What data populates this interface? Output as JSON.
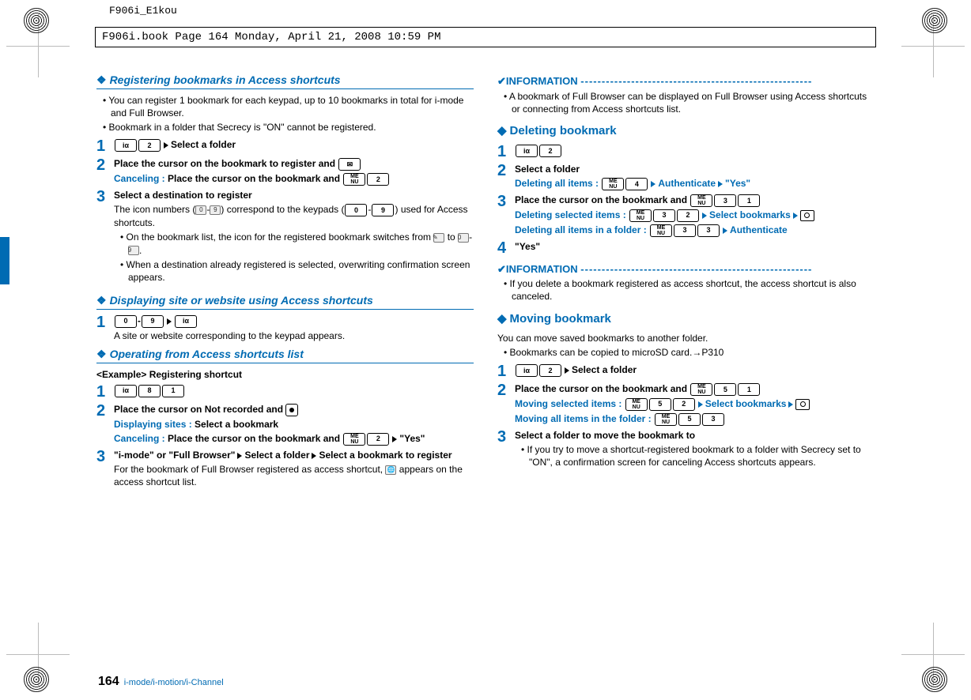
{
  "doc": {
    "id": "F906i_E1kou",
    "book_info": "F906i.book  Page 164  Monday, April 21, 2008  10:59 PM",
    "page_number": "164",
    "footer": "i-mode/i-motion/i-Channel"
  },
  "keys": {
    "i": "iα",
    "menu": "ME\nNU",
    "n0": "0",
    "n1": "1",
    "n2": "2",
    "n3": "3",
    "n4": "4",
    "n5": "5",
    "n8": "8",
    "n9": "9",
    "mail": "✉"
  },
  "left": {
    "s1": {
      "title": "Registering bookmarks in Access shortcuts",
      "b1": "You can register 1 bookmark for each keypad, up to 10 bookmarks in total for i-mode and Full Browser.",
      "b2": "Bookmark in a folder that Secrecy is \"ON\" cannot be registered.",
      "step1_tail": "Select a folder",
      "step2_title": "Place the cursor on the bookmark to register and ",
      "step2_cancel_label": "Canceling : ",
      "step2_cancel_text": "Place the cursor on the bookmark and ",
      "step3_title": "Select a destination to register",
      "step3_text": "The icon numbers ( - ) correspond to the keypads ( - ) used for Access shortcuts.",
      "step3_prefix": "The icon numbers (",
      "step3_mid": ") correspond to the keypads (",
      "step3_suffix": ") used for Access shortcuts.",
      "step3_b1a": "On the bookmark list, the icon for the registered bookmark switches from ",
      "step3_b1b": " to ",
      "step3_b1c": ".",
      "step3_b2": "When a destination already registered is selected, overwriting confirmation screen appears."
    },
    "s2": {
      "title": "Displaying site or website using Access shortcuts",
      "step1_text": "A site or website corresponding to the keypad appears."
    },
    "s3": {
      "title": "Operating from Access shortcuts list",
      "example": "<Example> Registering shortcut",
      "step2_title": "Place the cursor on Not recorded and ",
      "step2_disp_label": "Displaying sites : ",
      "step2_disp_text": "Select a bookmark",
      "step2_cancel_label": "Canceling : ",
      "step2_cancel_text": "Place the cursor on the bookmark and ",
      "step2_cancel_tail": "\"Yes\"",
      "step3_a": "\"i-mode\" or \"Full Browser\"",
      "step3_b": "Select a folder",
      "step3_c": "Select a bookmark to register",
      "step3_text_a": "For the bookmark of Full Browser registered as access shortcut, ",
      "step3_text_b": " appears on the access shortcut list."
    }
  },
  "right": {
    "info1": {
      "label": "INFORMATION",
      "b1": "A bookmark of Full Browser can be displayed on Full Browser using Access shortcuts or connecting from Access shortcuts list."
    },
    "s1": {
      "title": "Deleting bookmark",
      "step2_title": "Select a folder",
      "step2_del_label": "Deleting all items : ",
      "step2_del_a": "Authenticate",
      "step2_del_b": "\"Yes\"",
      "step3_title": "Place the cursor on the bookmark and ",
      "step3_sel_label": "Deleting selected items : ",
      "step3_sel_text": "Select bookmarks",
      "step3_all_label": "Deleting all items in a folder : ",
      "step3_all_text": "Authenticate",
      "step4_text": "\"Yes\""
    },
    "info2": {
      "label": "INFORMATION",
      "b1": "If you delete a bookmark registered as access shortcut, the access shortcut is also canceled."
    },
    "s2": {
      "title": "Moving bookmark",
      "intro": "You can move saved bookmarks to another folder.",
      "b1": "Bookmarks can be copied to microSD card.→P310",
      "step1_tail": "Select a folder",
      "step2_title": "Place the cursor on the bookmark and ",
      "step2_sel_label": "Moving selected items : ",
      "step2_sel_text": "Select bookmarks",
      "step2_all_label": "Moving all items in the folder : ",
      "step3_title": "Select a folder to move the bookmark to",
      "step3_b1": "If you try to move a shortcut-registered bookmark to a folder with Secrecy set to \"ON\", a confirmation screen for canceling Access shortcuts appears."
    }
  }
}
